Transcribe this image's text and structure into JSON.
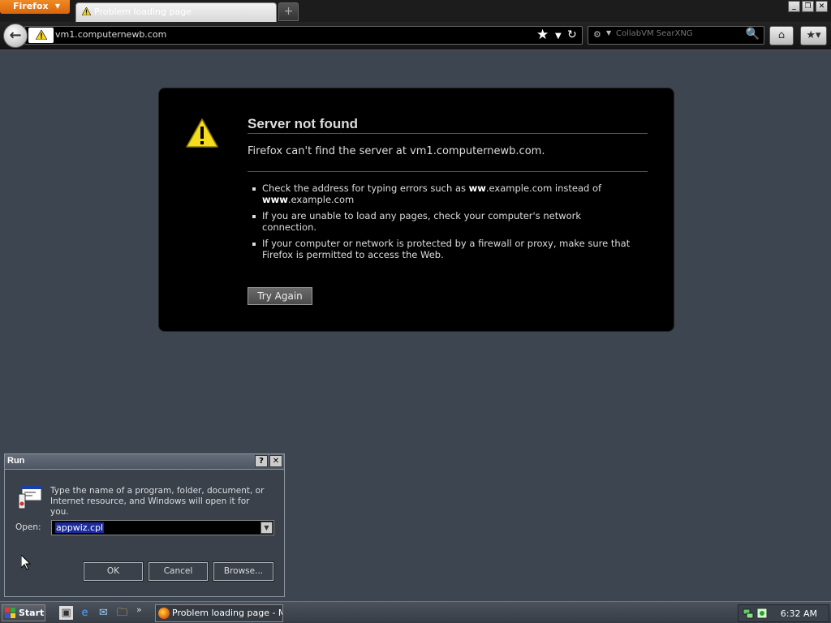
{
  "browser": {
    "menu_button": "Firefox",
    "tab_title": "Problem loading page",
    "new_tab_glyph": "+",
    "url": "vm1.computernewb.com",
    "search_placeholder": "CollabVM SearXNG",
    "window_buttons": [
      "_",
      "❐",
      "✕"
    ]
  },
  "error_page": {
    "title": "Server not found",
    "description": "Firefox can't find the server at vm1.computernewb.com.",
    "bullets": {
      "b1_pre": "Check the address for typing errors such as ",
      "b1_bold1": "ww",
      "b1_mid": ".example.com instead of ",
      "b1_bold2": "www",
      "b1_post": ".example.com",
      "b2": "If you are unable to load any pages, check your computer's network connection.",
      "b3": "If your computer or network is protected by a firewall or proxy, make sure that Firefox is permitted to access the Web."
    },
    "try_again": "Try Again"
  },
  "run_dialog": {
    "title": "Run",
    "help_glyph": "?",
    "close_glyph": "✕",
    "description": "Type the name of a program, folder, document, or Internet resource, and Windows will open it for you.",
    "open_label": "Open:",
    "open_value": "appwiz.cpl",
    "ok": "OK",
    "cancel": "Cancel",
    "browse": "Browse..."
  },
  "taskbar": {
    "start": "Start",
    "task_firefox": "Problem loading page - M...",
    "more_glyph": "»",
    "clock": "6:32 AM"
  },
  "icons": {
    "back": "back-arrow-icon",
    "star": "bookmark-star-icon",
    "reload": "reload-icon",
    "home": "home-icon",
    "bookmarks": "bookmarks-menu-icon",
    "search": "magnifier-icon",
    "warning": "warning-triangle-icon"
  },
  "colors": {
    "desktop": "#3d4550",
    "firefox_orange": "#e8750f",
    "error_box": "#000000",
    "selection": "#1a2a9c"
  }
}
